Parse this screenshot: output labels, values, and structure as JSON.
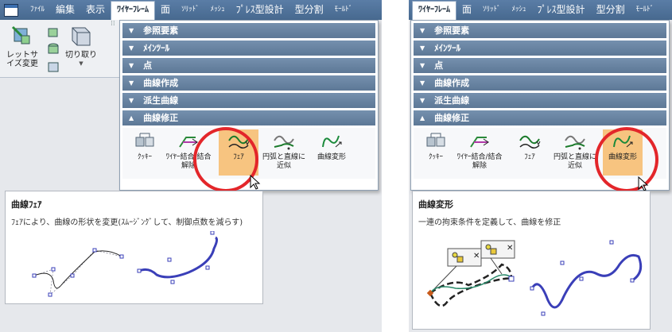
{
  "left": {
    "menu": [
      "ﾌｧｲﾙ",
      "編集",
      "表示",
      "ﾜｲﾔｰﾌﾚｰﾑ",
      "面",
      "ｿﾘｯﾄﾞ",
      "ﾒｯｼｭ",
      "ﾌﾟﾚｽ型設計",
      "型分割",
      "ﾓｰﾙﾄﾞ"
    ],
    "ribbon": {
      "resize_label": "レットサイズ変更",
      "cut_label": "切り取り"
    },
    "sections": [
      "参照要素",
      "ﾒｲﾝﾂｰﾙ",
      "点",
      "曲線作成",
      "派生曲線",
      "曲線修正"
    ],
    "tools": [
      "ｸｯｷｰ",
      "ﾜｲﾔｰ結合/結合解除",
      "ﾌｪｱ",
      "円弧と直線に近似",
      "曲線変形"
    ],
    "card": {
      "title": "曲線ﾌｪｱ",
      "description": "ﾌｪｱにより、曲線の形状を変更(ｽﾑｰｼﾞﾝｸﾞして、制御点数を減らす)"
    }
  },
  "right": {
    "menu": [
      "ﾜｲﾔｰﾌﾚｰﾑ",
      "面",
      "ｿﾘｯﾄﾞ",
      "ﾒｯｼｭ",
      "ﾌﾟﾚｽ型設計",
      "型分割",
      "ﾓｰﾙﾄﾞ"
    ],
    "sections": [
      "参照要素",
      "ﾒｲﾝﾂｰﾙ",
      "点",
      "曲線作成",
      "派生曲線",
      "曲線修正"
    ],
    "tools": [
      "ｸｯｷｰ",
      "ﾜｲﾔｰ結合/結合解除",
      "ﾌｪｱ",
      "円弧と直線に近似",
      "曲線変形"
    ],
    "card": {
      "title": "曲線変形",
      "description": "一連の拘束条件を定義して、曲線を修正"
    }
  },
  "colors": {
    "menubar": "#4f7299",
    "section_header": "#6883a2",
    "highlight": "#f7c480",
    "annotation_circle": "#e3262a",
    "curve": "#3a3fb8"
  }
}
